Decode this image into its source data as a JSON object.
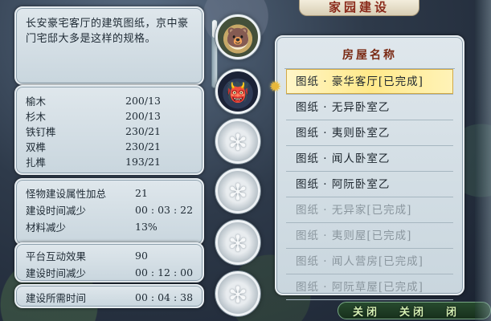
{
  "description": "长安豪宅客厅的建筑图纸，京中豪门宅邸大多是这样的规格。",
  "materials": [
    {
      "name": "榆木",
      "value": "200/13"
    },
    {
      "name": "杉木",
      "value": "200/13"
    },
    {
      "name": "铁钉榫",
      "value": "230/21"
    },
    {
      "name": "双榫",
      "value": "230/21"
    },
    {
      "name": "扎榫",
      "value": "193/21"
    }
  ],
  "stats": [
    {
      "name": "怪物建设属性加总",
      "value": "21"
    },
    {
      "name": "建设时间减少",
      "value": "00 : 03 : 22"
    },
    {
      "name": "材料减少",
      "value": "13%"
    }
  ],
  "stats2": [
    {
      "name": "平台互动效果",
      "value": "90"
    },
    {
      "name": "建设时间减少",
      "value": "00 : 12 : 00"
    }
  ],
  "total": {
    "name": "建设所需时间",
    "value": "00 : 04 : 38"
  },
  "title": "家园建设",
  "list": {
    "header": "房屋名称",
    "items": [
      {
        "label": "图纸 · 豪华客厅[已完成]",
        "state": "selected"
      },
      {
        "label": "图纸 · 无异卧室乙",
        "state": "normal"
      },
      {
        "label": "图纸 · 夷则卧室乙",
        "state": "normal"
      },
      {
        "label": "图纸 · 闻人卧室乙",
        "state": "normal"
      },
      {
        "label": "图纸 · 阿阮卧室乙",
        "state": "normal"
      },
      {
        "label": "图纸 · 无异家[已完成]",
        "state": "done"
      },
      {
        "label": "图纸 · 夷则屋[已完成]",
        "state": "done"
      },
      {
        "label": "图纸 · 闻人营房[已完成]",
        "state": "done"
      },
      {
        "label": "图纸 · 阿阮草屋[已完成]",
        "state": "done"
      }
    ]
  },
  "buttons": {
    "close1": "关闭",
    "close2": "关闭",
    "more": "闭"
  },
  "portraits": [
    {
      "kind": "bear"
    },
    {
      "kind": "beast"
    },
    {
      "kind": "locked"
    },
    {
      "kind": "locked"
    },
    {
      "kind": "locked"
    },
    {
      "kind": "locked"
    }
  ],
  "colors": {
    "accent_title": "#8a2a1a",
    "selected_row": "#ffe98a",
    "done_text": "#8a969e",
    "button_bg": "#274a2e"
  }
}
